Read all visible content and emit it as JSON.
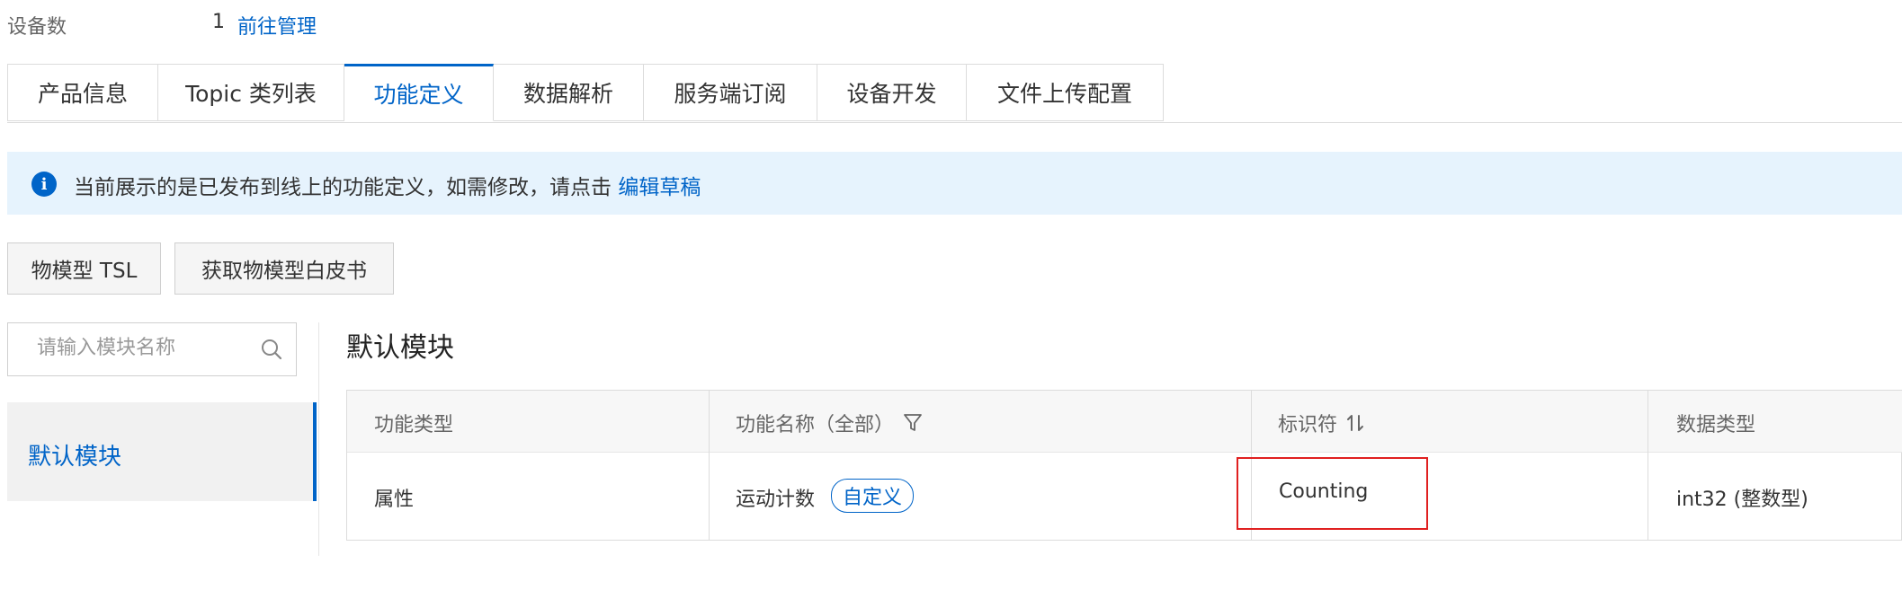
{
  "meta": {
    "label": "设备数",
    "count": "1",
    "manage_link": "前往管理"
  },
  "tabs": [
    "产品信息",
    "Topic 类列表",
    "功能定义",
    "数据解析",
    "服务端订阅",
    "设备开发",
    "文件上传配置"
  ],
  "notice": {
    "text": "当前展示的是已发布到线上的功能定义，如需修改，请点击 ",
    "link": "编辑草稿"
  },
  "buttons": {
    "tsl": "物模型 TSL",
    "whitepaper": "获取物模型白皮书"
  },
  "search": {
    "placeholder": "请输入模块名称"
  },
  "sidebar": {
    "active_item": "默认模块"
  },
  "module": {
    "title": "默认模块"
  },
  "table": {
    "headers": {
      "type": "功能类型",
      "name": "功能名称（全部）",
      "identifier": "标识符",
      "datatype": "数据类型"
    },
    "rows": [
      {
        "type": "属性",
        "name": "运动计数",
        "tag": "自定义",
        "identifier": "Counting",
        "datatype": "int32 (整数型)"
      }
    ]
  },
  "colors": {
    "accent": "#0064c8",
    "notice_bg": "#e6f3fd",
    "highlight": "#e02020"
  }
}
